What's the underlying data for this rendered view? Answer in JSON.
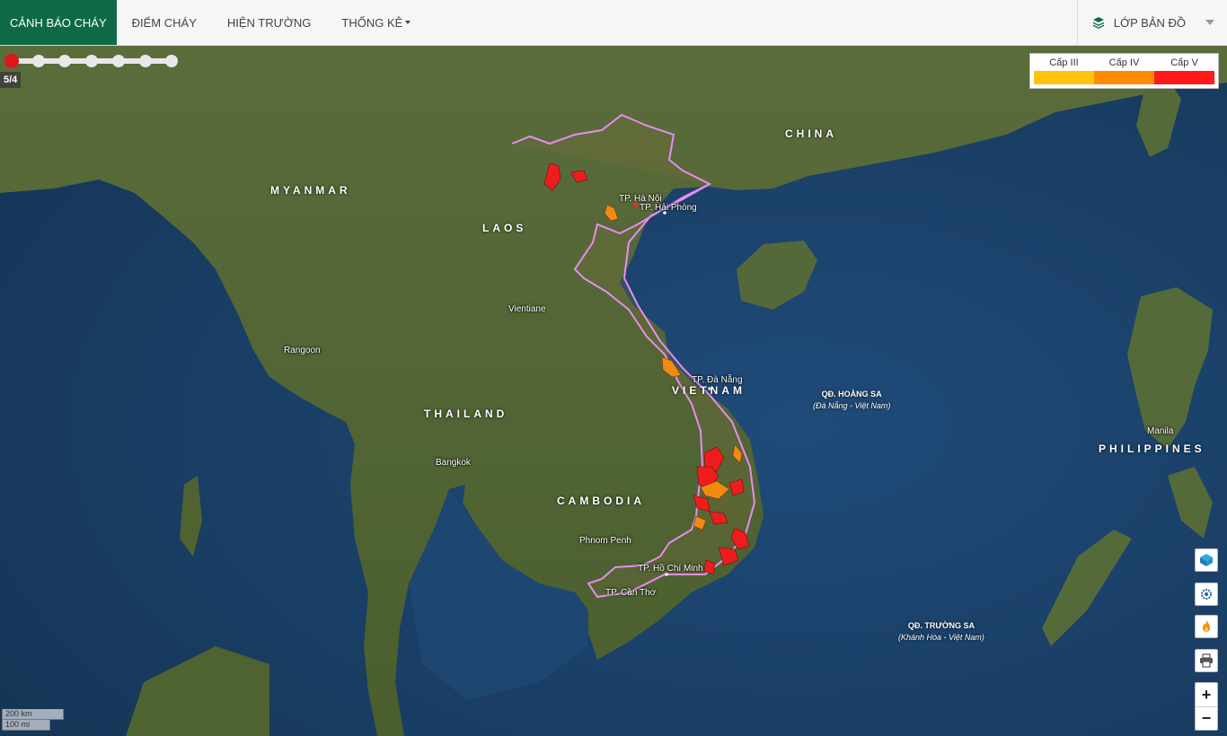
{
  "nav": {
    "items": [
      {
        "label": "CẢNH BÁO CHÁY",
        "active": true
      },
      {
        "label": "ĐIỂM CHÁY",
        "active": false
      },
      {
        "label": "HIỆN TRƯỜNG",
        "active": false
      },
      {
        "label": "THỐNG KÊ",
        "active": false,
        "dropdown": true
      }
    ],
    "layers_label": "LỚP BẢN ĐỒ"
  },
  "timeline": {
    "date_label": "5/4",
    "steps": 7,
    "selected_index": 0
  },
  "legend": {
    "items": [
      {
        "label": "Cấp III",
        "color": "#ffc20e"
      },
      {
        "label": "Cấp IV",
        "color": "#ff8c00"
      },
      {
        "label": "Cấp V",
        "color": "#ff1a1a"
      }
    ]
  },
  "map": {
    "countries": [
      "MYANMAR",
      "LAOS",
      "CHINA",
      "THAILAND",
      "CAMBODIA",
      "VIETNAM",
      "PHILIPPINES"
    ],
    "cities": [
      "TP. Hà Nội",
      "TP. Hải Phòng",
      "Vientiane",
      "Rangoon",
      "TP. Đà Nẵng",
      "Bangkok",
      "Phnom Penh",
      "TP. Hồ Chí Minh",
      "TP. Cần Thơ",
      "Manila"
    ],
    "islands": [
      {
        "name": "QĐ. HOÀNG SA",
        "sub": "(Đà Nẵng - Việt Nam)"
      },
      {
        "name": "QĐ. TRƯỜNG SA",
        "sub": "(Khánh Hòa - Việt Nam)"
      }
    ],
    "border_color": "#e58ef0",
    "ocean_color": "#1c3f66",
    "land_color": "#4f6330"
  },
  "scale": {
    "km": "200 km",
    "mi": "100 mi"
  },
  "tools": [
    {
      "icon": "layers-cube-icon"
    },
    {
      "icon": "settings-gear-icon"
    },
    {
      "icon": "fire-icon"
    },
    {
      "icon": "print-icon"
    }
  ],
  "zoom": {
    "in": "+",
    "out": "−"
  }
}
